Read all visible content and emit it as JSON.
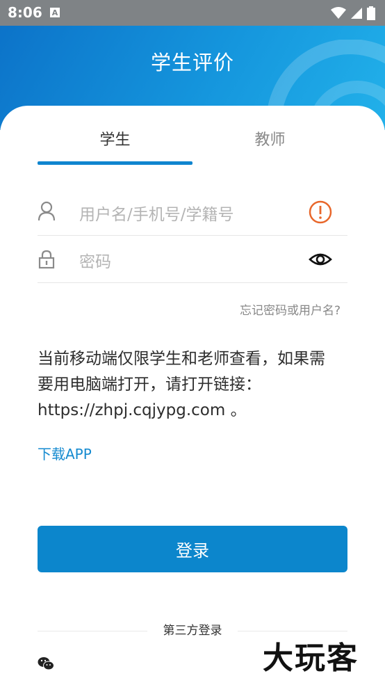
{
  "status_bar": {
    "time": "8:06",
    "app_badge": "A"
  },
  "header": {
    "title": "学生评价"
  },
  "tabs": [
    {
      "label": "学生",
      "active": true
    },
    {
      "label": "教师",
      "active": false
    }
  ],
  "username": {
    "placeholder": "用户名/手机号/学籍号",
    "warning_icon": "alert-circle-icon"
  },
  "password": {
    "placeholder": "密码",
    "toggle_icon": "eye-icon"
  },
  "forgot_link": "忘记密码或用户名?",
  "notice": {
    "line1": "当前移动端仅限学生和老师查看，如果需",
    "line2": "要用电脑端打开，请打开链接：",
    "line3": "https://zhpj.cqjypg.com 。"
  },
  "download_link": "下载APP",
  "login_button": "登录",
  "third_party": {
    "label": "第三方登录",
    "provider_icon": "wechat-icon"
  },
  "watermark": "大玩客",
  "colors": {
    "primary": "#0c86cc",
    "warning": "#e8672b",
    "status_bar": "#7f8386"
  }
}
